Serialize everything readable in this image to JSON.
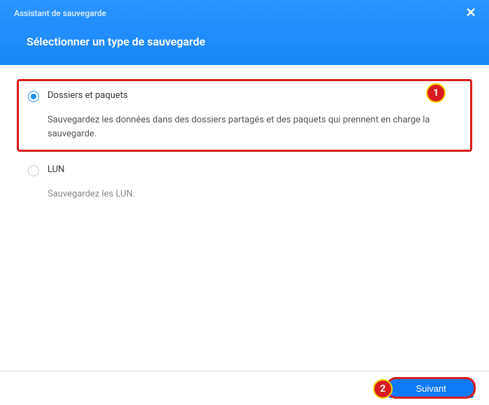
{
  "header": {
    "wizard_title": "Assistant de sauvegarde",
    "page_title": "Sélectionner un type de sauvegarde",
    "close_glyph": "✕"
  },
  "options": {
    "folders": {
      "title": "Dossiers et paquets",
      "desc": "Sauvegardez les données dans des dossiers partagés et des paquets qui prennent en charge la sauvegarde.",
      "selected": true
    },
    "lun": {
      "title": "LUN",
      "desc": "Sauvegardez les LUN.",
      "selected": false
    }
  },
  "annotations": {
    "step1": "1",
    "step2": "2"
  },
  "footer": {
    "next_label": "Suivant"
  }
}
